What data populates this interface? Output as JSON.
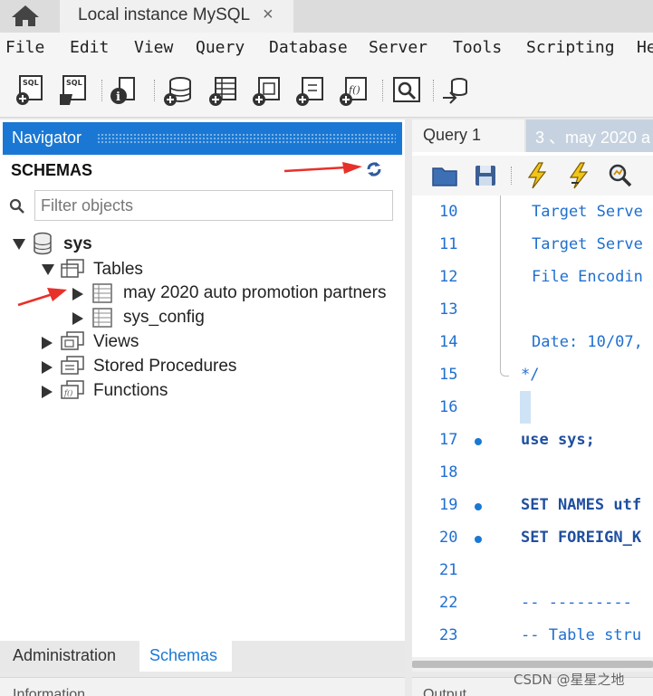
{
  "window": {
    "tab_title": "Local instance MySQL",
    "close_glyph": "×"
  },
  "menu": [
    "File",
    "Edit",
    "View",
    "Query",
    "Database",
    "Server",
    "Tools",
    "Scripting",
    "He"
  ],
  "toolbar": {
    "buttons": [
      "new-sql-tab-icon",
      "open-sql-script-icon",
      "inspector-icon",
      "create-schema-icon",
      "create-table-icon",
      "create-view-icon",
      "create-procedure-icon",
      "create-function-icon",
      "search-table-data-icon",
      "reconnect-icon"
    ]
  },
  "navigator": {
    "title": "Navigator",
    "schemas_label": "SCHEMAS",
    "filter_placeholder": "Filter objects",
    "tree": {
      "schema": "sys",
      "tables": "Tables",
      "table_items": [
        "may 2020 auto promotion partners",
        "sys_config"
      ],
      "views": "Views",
      "procedures": "Stored Procedures",
      "functions": "Functions"
    },
    "tabs": {
      "admin": "Administration",
      "schemas": "Schemas"
    },
    "info_label": "Information"
  },
  "editor": {
    "tabs": {
      "query1": "Query 1",
      "may": "3 、may 2020 a"
    },
    "toolbar": [
      "open-folder-icon",
      "save-icon",
      "execute-icon",
      "execute-current-icon",
      "explain-icon"
    ],
    "lines": [
      {
        "num": "10",
        "code": "Target Serve",
        "type": "comment",
        "dot": false
      },
      {
        "num": "11",
        "code": "Target Serve",
        "type": "comment",
        "dot": false
      },
      {
        "num": "12",
        "code": "File Encodin",
        "type": "comment",
        "dot": false
      },
      {
        "num": "13",
        "code": "",
        "type": "comment",
        "dot": false
      },
      {
        "num": "14",
        "code": "Date: 10/07,",
        "type": "comment",
        "dot": false
      },
      {
        "num": "15",
        "code": "*/",
        "type": "comment",
        "dot": false
      },
      {
        "num": "16",
        "code": "",
        "type": "plain",
        "dot": false
      },
      {
        "num": "17",
        "code": "use sys;",
        "type": "keyword",
        "dot": true
      },
      {
        "num": "18",
        "code": "",
        "type": "plain",
        "dot": false
      },
      {
        "num": "19",
        "code": "SET NAMES utf",
        "type": "keyword",
        "dot": true
      },
      {
        "num": "20",
        "code": "SET FOREIGN_K",
        "type": "keyword",
        "dot": true
      },
      {
        "num": "21",
        "code": "",
        "type": "plain",
        "dot": false
      },
      {
        "num": "22",
        "code": "-- ---------",
        "type": "comment",
        "dot": false
      },
      {
        "num": "23",
        "code": "-- Table stru",
        "type": "comment",
        "dot": false
      }
    ],
    "output_label": "Output"
  },
  "watermark": "CSDN @星星之地",
  "colors": {
    "accent": "#1a78d4",
    "annotation_arrow": "#e8302a"
  }
}
